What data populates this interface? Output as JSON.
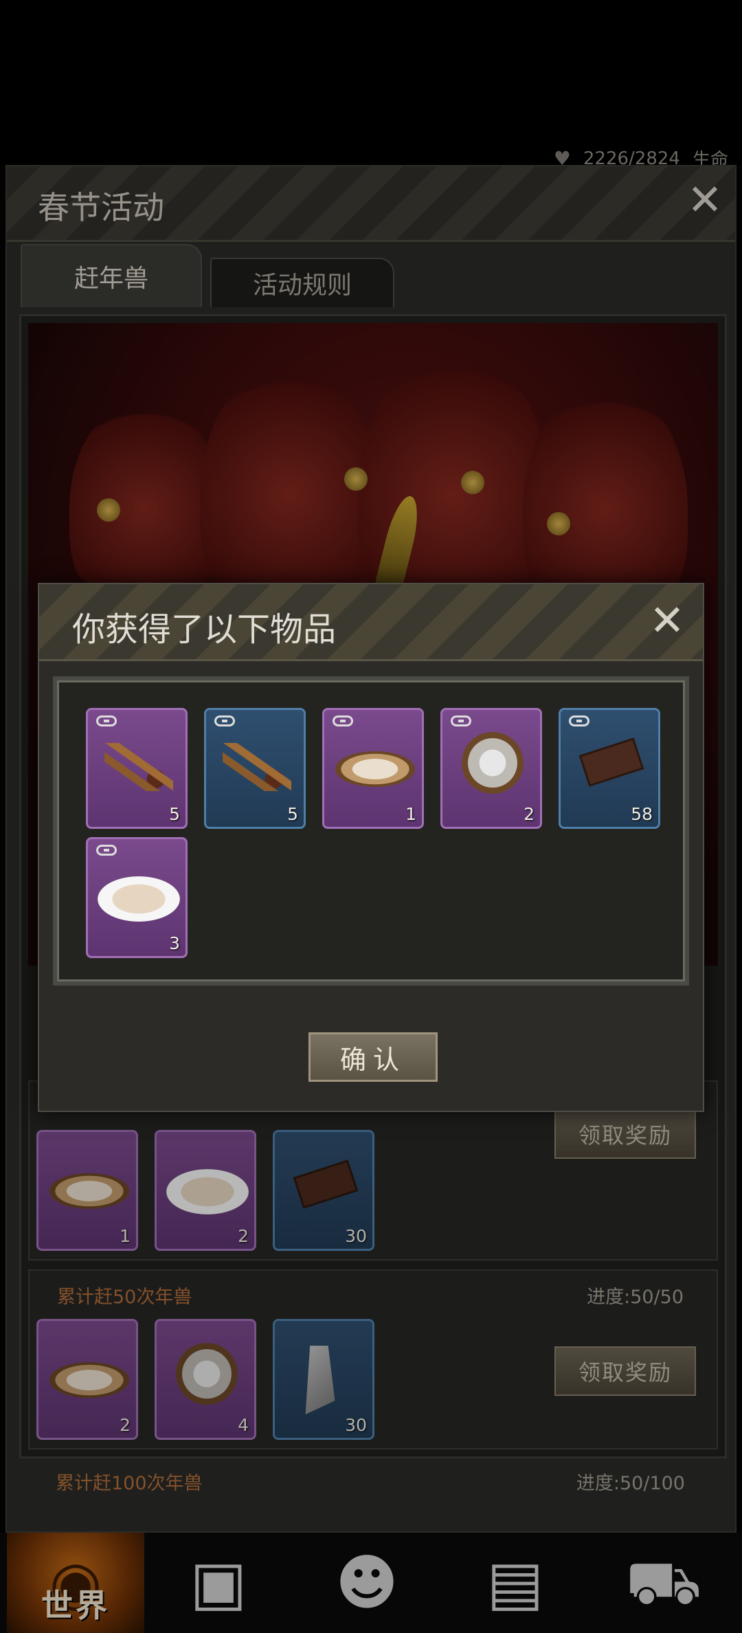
{
  "status": {
    "life_value": "2226/2824",
    "life_label": "生命"
  },
  "panel": {
    "title": "春节活动",
    "tabs": [
      {
        "label": "赶年兽"
      },
      {
        "label": "活动规则"
      }
    ]
  },
  "tasks": [
    {
      "claim_label": "领取奖励",
      "items": [
        {
          "icon": "plate-icon",
          "rarity": "purple",
          "count": "1"
        },
        {
          "icon": "dumplings-icon",
          "rarity": "purple",
          "count": "2"
        },
        {
          "icon": "chocolate-icon",
          "rarity": "blue",
          "count": "30"
        }
      ]
    },
    {
      "title": "累计赶50次年兽",
      "progress": "进度:50/50",
      "claim_label": "领取奖励",
      "items": [
        {
          "icon": "plate-icon",
          "rarity": "purple",
          "count": "2"
        },
        {
          "icon": "rice-balls-icon",
          "rarity": "purple",
          "count": "4"
        },
        {
          "icon": "stone-icon",
          "rarity": "blue",
          "count": "30"
        }
      ]
    },
    {
      "title": "累计赶100次年兽",
      "progress": "进度:50/100"
    }
  ],
  "modal": {
    "title": "你获得了以下物品",
    "confirm_label": "确认",
    "items": [
      {
        "icon": "spices-icon",
        "rarity": "purple",
        "count": "5"
      },
      {
        "icon": "spices-icon",
        "rarity": "blue",
        "count": "5"
      },
      {
        "icon": "plate-icon",
        "rarity": "purple",
        "count": "1"
      },
      {
        "icon": "rice-balls-icon",
        "rarity": "purple",
        "count": "2"
      },
      {
        "icon": "chocolate-icon",
        "rarity": "blue",
        "count": "58"
      },
      {
        "icon": "dumplings-icon",
        "rarity": "purple",
        "count": "3"
      }
    ]
  },
  "nav": {
    "world_label": "世界"
  }
}
